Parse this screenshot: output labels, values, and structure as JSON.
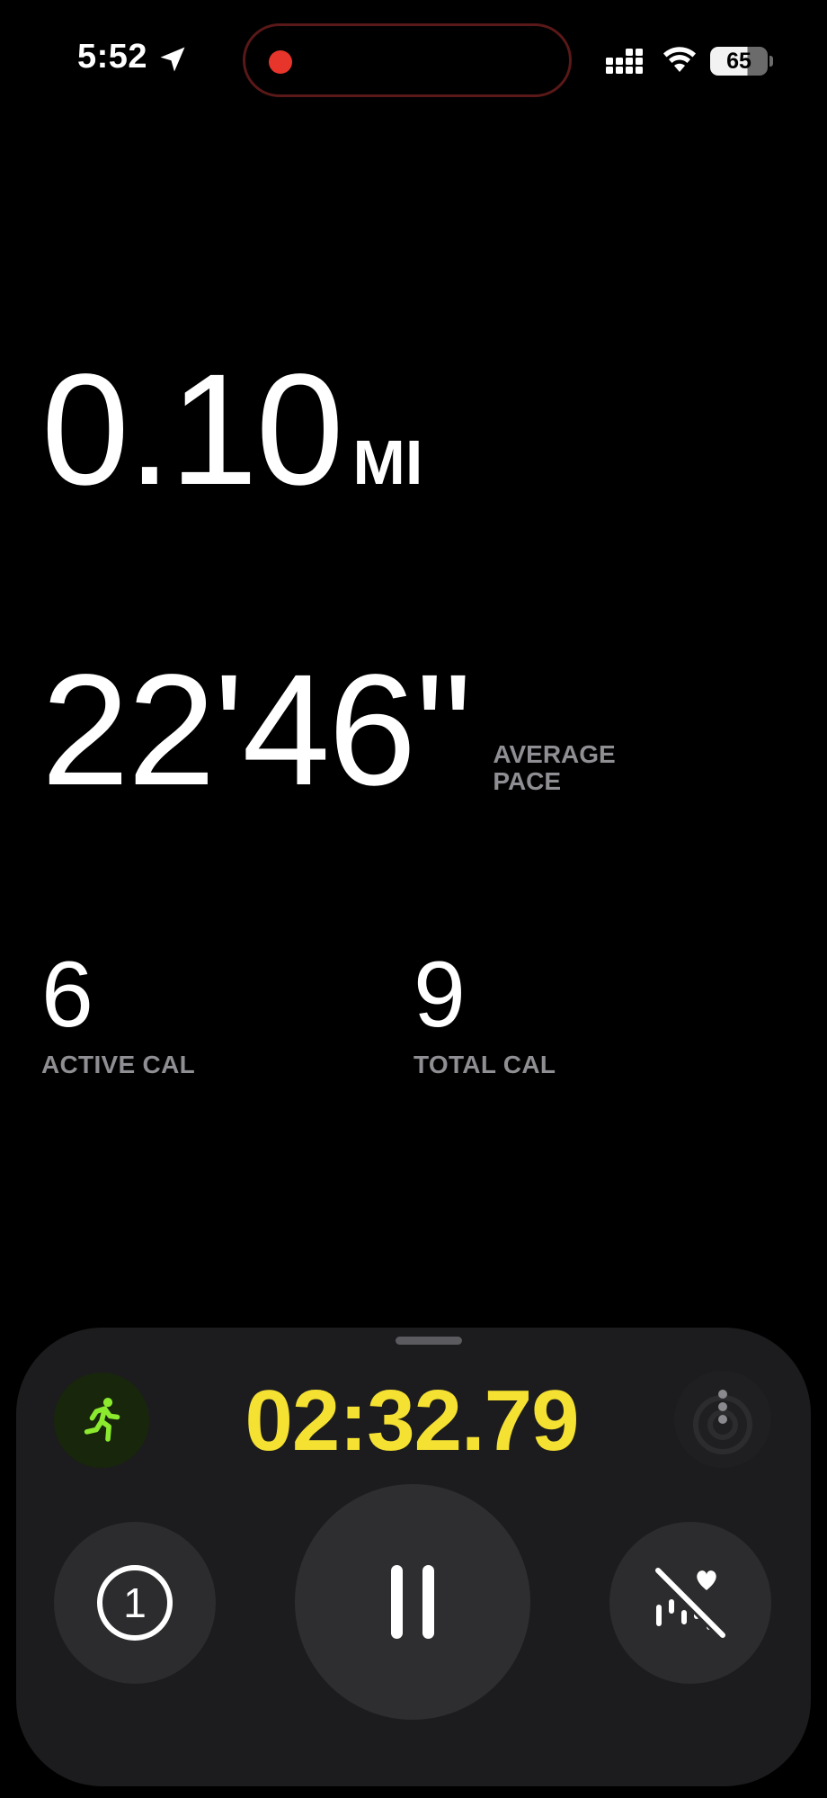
{
  "status_bar": {
    "time": "5:52",
    "battery_level": "65",
    "icons": [
      "location-arrow-icon",
      "signal-icon",
      "wifi-icon",
      "battery-icon"
    ]
  },
  "metrics": {
    "distance": {
      "value": "0.10",
      "unit": "MI"
    },
    "pace": {
      "value": "22'46''",
      "label": "AVERAGE PACE"
    },
    "active_cal": {
      "value": "6",
      "label": "ACTIVE CAL"
    },
    "total_cal": {
      "value": "9",
      "label": "TOTAL CAL"
    }
  },
  "controls": {
    "elapsed_time": "02:32.79",
    "segment_number": "1",
    "workout_icon": "running-figure-icon",
    "buttons": [
      "segment-icon",
      "pause-icon",
      "heart-rate-muted-icon",
      "more-icon"
    ]
  },
  "colors": {
    "background": "#000000",
    "panel": "#1c1c1e",
    "timer": "#f5e131",
    "workout_accent": "#8bea2e",
    "recording_dot": "#e8352b",
    "secondary_text": "#8e8e93"
  }
}
